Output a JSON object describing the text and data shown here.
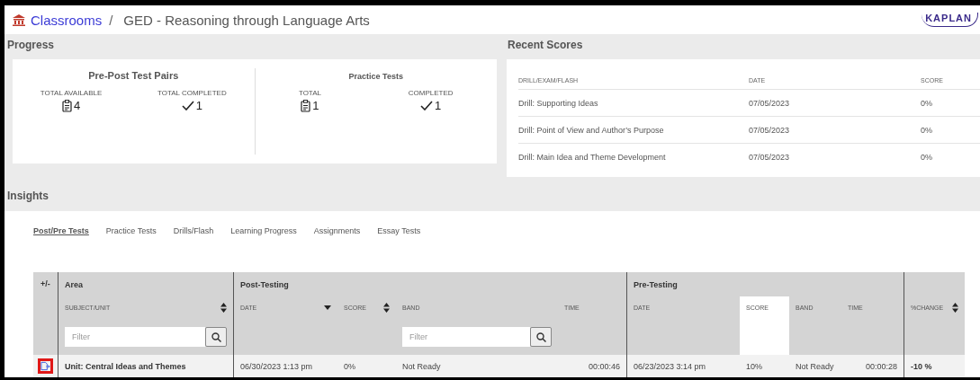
{
  "header": {
    "breadcrumb_link": "Classrooms",
    "separator": "/",
    "title": "GED - Reasoning through Language Arts",
    "logo": "KAPLAN"
  },
  "progress": {
    "title": "Progress",
    "groups": [
      {
        "title": "Pre-Post Test Pairs",
        "stats": [
          {
            "label": "TOTAL AVAILABLE",
            "kind": "clipboard",
            "value": "4"
          },
          {
            "label": "TOTAL COMPLETED",
            "kind": "check",
            "value": "1"
          }
        ]
      },
      {
        "title": "Practice Tests",
        "stats": [
          {
            "label": "TOTAL",
            "kind": "clipboard",
            "value": "1"
          },
          {
            "label": "COMPLETED",
            "kind": "check",
            "value": "1"
          }
        ]
      }
    ]
  },
  "recent_scores": {
    "title": "Recent Scores",
    "columns": [
      "DRILL/EXAM/FLASH",
      "DATE",
      "SCORE"
    ],
    "rows": [
      [
        "Drill: Supporting Ideas",
        "07/05/2023",
        "0%"
      ],
      [
        "Drill: Point of View and Author’s Purpose",
        "07/05/2023",
        "0%"
      ],
      [
        "Drill: Main Idea and Theme Development",
        "07/05/2023",
        "0%"
      ]
    ]
  },
  "insights": {
    "title": "Insights",
    "tabs": [
      {
        "label": "Post/Pre Tests",
        "selected": true
      },
      {
        "label": "Practice Tests",
        "selected": false
      },
      {
        "label": "Drills/Flash",
        "selected": false
      },
      {
        "label": "Learning Progress",
        "selected": false
      },
      {
        "label": "Assignments",
        "selected": false
      },
      {
        "label": "Essay Tests",
        "selected": false
      }
    ],
    "table": {
      "expand_header": "+/-",
      "area": {
        "title": "Area",
        "column": {
          "label": "SUBJECT/UNIT",
          "sorted_descending": false,
          "highlighted": false,
          "filter_placeholder": "Filter"
        }
      },
      "groups": [
        {
          "title": "Post-Testing",
          "columns": [
            {
              "label": "DATE",
              "sorted_descending": true,
              "highlighted": false
            },
            {
              "label": "SCORE",
              "sorted_descending": false,
              "highlighted": false
            },
            {
              "label": "BAND",
              "highlighted": false,
              "filter_placeholder": "Filter"
            },
            {
              "label": "TIME",
              "highlighted": false
            }
          ]
        },
        {
          "title": "Pre-Testing",
          "columns": [
            {
              "label": "DATE",
              "highlighted": false
            },
            {
              "label": "SCORE",
              "highlighted": true
            },
            {
              "label": "BAND",
              "highlighted": false
            },
            {
              "label": "TIME",
              "highlighted": false
            }
          ]
        }
      ],
      "change_column": {
        "label": "%CHANGE",
        "sorted_descending": false,
        "highlighted": false
      },
      "rows": [
        {
          "marked": true,
          "cells": [
            "Unit: Central Ideas and Themes",
            "06/30/2023 1:13 pm",
            "0%",
            "Not Ready",
            "00:00:46",
            "06/23/2023 3:14 pm",
            "10%",
            "Not Ready",
            "00:00:28",
            "-10 %"
          ]
        }
      ]
    }
  }
}
